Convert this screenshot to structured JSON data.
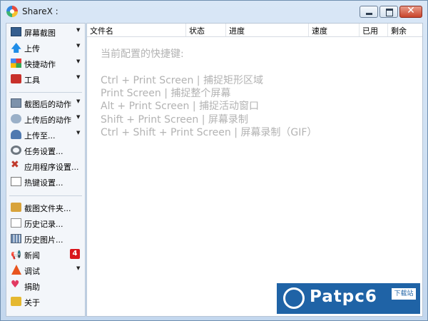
{
  "window": {
    "title": "ShareX :"
  },
  "sidebar": {
    "items": [
      {
        "label": "屏幕截图",
        "icon": "screen-capture-icon",
        "arrow": "▼"
      },
      {
        "label": "上传",
        "icon": "upload-arrow-icon",
        "arrow": "▼"
      },
      {
        "label": "快捷动作",
        "icon": "workflow-grid-icon",
        "arrow": "▼"
      },
      {
        "label": "工具",
        "icon": "toolbox-icon",
        "arrow": "▼"
      },
      {
        "label": "截图后的动作",
        "icon": "after-capture-icon",
        "arrow": "▼"
      },
      {
        "label": "上传后的动作",
        "icon": "after-upload-cloud-icon",
        "arrow": "▼"
      },
      {
        "label": "上传至...",
        "icon": "upload-destination-icon",
        "arrow": "▼"
      },
      {
        "label": "任务设置...",
        "icon": "gear-icon",
        "arrow": ""
      },
      {
        "label": "应用程序设置...",
        "icon": "wrench-icon",
        "arrow": ""
      },
      {
        "label": "热键设置...",
        "icon": "hotkey-icon",
        "arrow": ""
      },
      {
        "label": "截图文件夹...",
        "icon": "folder-icon",
        "arrow": ""
      },
      {
        "label": "历史记录...",
        "icon": "history-icon",
        "arrow": ""
      },
      {
        "label": "历史图片...",
        "icon": "image-history-icon",
        "arrow": ""
      },
      {
        "label": "新闻",
        "icon": "news-megaphone-icon",
        "arrow": "",
        "badge": "4"
      },
      {
        "label": "调试",
        "icon": "debug-cone-icon",
        "arrow": "▼"
      },
      {
        "label": "捐助",
        "icon": "heart-icon",
        "arrow": ""
      },
      {
        "label": "关于",
        "icon": "about-crown-icon",
        "arrow": ""
      }
    ]
  },
  "table": {
    "columns": [
      "文件名",
      "状态",
      "进度",
      "速度",
      "已用",
      "剩余"
    ]
  },
  "hints": {
    "title": "当前配置的快捷键:",
    "lines": [
      "Ctrl + Print Screen  |  捕捉矩形区域",
      "Print Screen  |  捕捉整个屏幕",
      "Alt + Print Screen  |  捕捉活动窗口",
      "Shift + Print Screen  |  屏幕录制",
      "Ctrl + Shift + Print Screen  |  屏幕录制（GIF）"
    ]
  },
  "watermark": {
    "brand": "Patpc6",
    "box_text": "下载站"
  },
  "colors": {
    "accent": "#1f63a6",
    "badge": "#d9161c",
    "hint_text": "#b3b3b3"
  }
}
